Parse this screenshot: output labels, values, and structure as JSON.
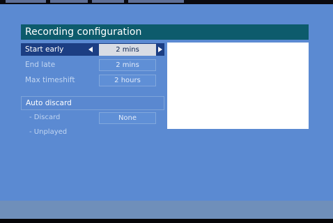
{
  "dialog": {
    "title": "Recording configuration"
  },
  "settings": [
    {
      "label": "Start early",
      "value": "2 mins",
      "selected": true
    },
    {
      "label": "End late",
      "value": "2 mins",
      "selected": false
    },
    {
      "label": "Max timeshift",
      "value": "2 hours",
      "selected": false
    }
  ],
  "auto_discard": {
    "header": "Auto discard",
    "items": [
      {
        "label": "- Discard",
        "value": "None"
      },
      {
        "label": "- Unplayed",
        "value": ""
      }
    ]
  },
  "icons": {
    "value_decrease": "arrow-left-icon",
    "value_increase": "arrow-right-icon"
  },
  "colors": {
    "background": "#5b8ad2",
    "title_bar": "#0d5b6c",
    "selected_row": "#1c3e83",
    "selected_value": "#d8dce4"
  }
}
